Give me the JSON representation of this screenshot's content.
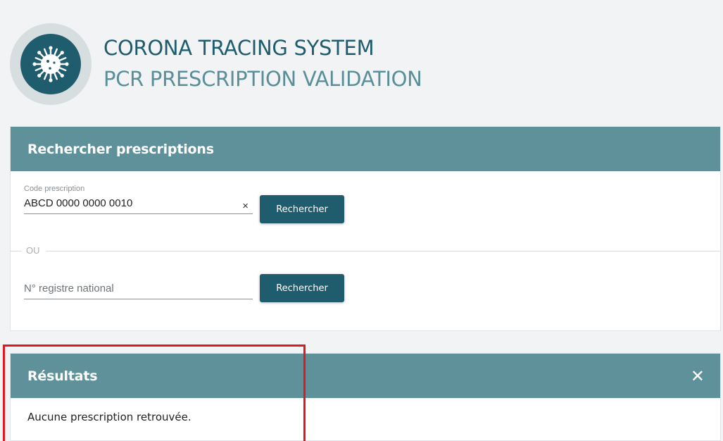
{
  "header": {
    "title": "CORONA TRACING SYSTEM",
    "subtitle": "PCR PRESCRIPTION VALIDATION",
    "logo_icon": "virus-icon"
  },
  "search": {
    "panel_title": "Rechercher prescriptions",
    "code_label": "Code prescription",
    "code_value": "ABCD 0000 0000 0010",
    "clear_symbol": "×",
    "search_button_1": "Rechercher",
    "divider_text": "OU",
    "nrn_placeholder": "N° registre national",
    "search_button_2": "Rechercher"
  },
  "results": {
    "panel_title": "Résultats",
    "close_symbol": "✕",
    "message": "Aucune prescription retrouvée."
  },
  "colors": {
    "primary": "#1f5d6e",
    "panel_header": "#5f919a",
    "highlight": "#e0181f"
  }
}
